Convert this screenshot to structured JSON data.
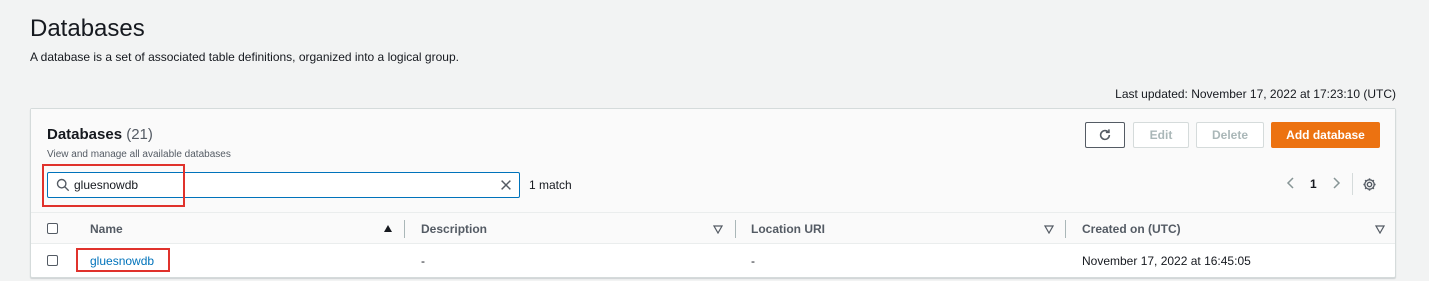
{
  "page": {
    "title": "Databases",
    "description": "A database is a set of associated table definitions, organized into a logical group.",
    "last_updated": "Last updated: November 17, 2022 at 17:23:10 (UTC)"
  },
  "panel": {
    "title": "Databases",
    "count": "(21)",
    "description": "View and manage all available databases",
    "buttons": {
      "edit": "Edit",
      "delete": "Delete",
      "add": "Add database"
    },
    "search": {
      "value": "gluesnowdb",
      "placeholder": "Filter databases",
      "match_count": "1 match"
    },
    "pagination": {
      "current_page": "1"
    },
    "columns": [
      {
        "label": "Name",
        "sort": "ascending"
      },
      {
        "label": "Description",
        "sort": "none"
      },
      {
        "label": "Location URI",
        "sort": "none"
      },
      {
        "label": "Created on (UTC)",
        "sort": "none"
      }
    ],
    "rows": [
      {
        "name": "gluesnowdb",
        "description": "-",
        "location_uri": "-",
        "created_on": "November 17, 2022 at 16:45:05"
      }
    ]
  },
  "colors": {
    "accent": "#ec7211",
    "link": "#0073bb",
    "highlight": "#e0322c"
  },
  "icons": [
    "refresh-icon",
    "search-icon",
    "clear-icon",
    "chevron-left-icon",
    "chevron-right-icon",
    "settings-gear-icon",
    "sort-ascending-icon",
    "sort-icon"
  ]
}
